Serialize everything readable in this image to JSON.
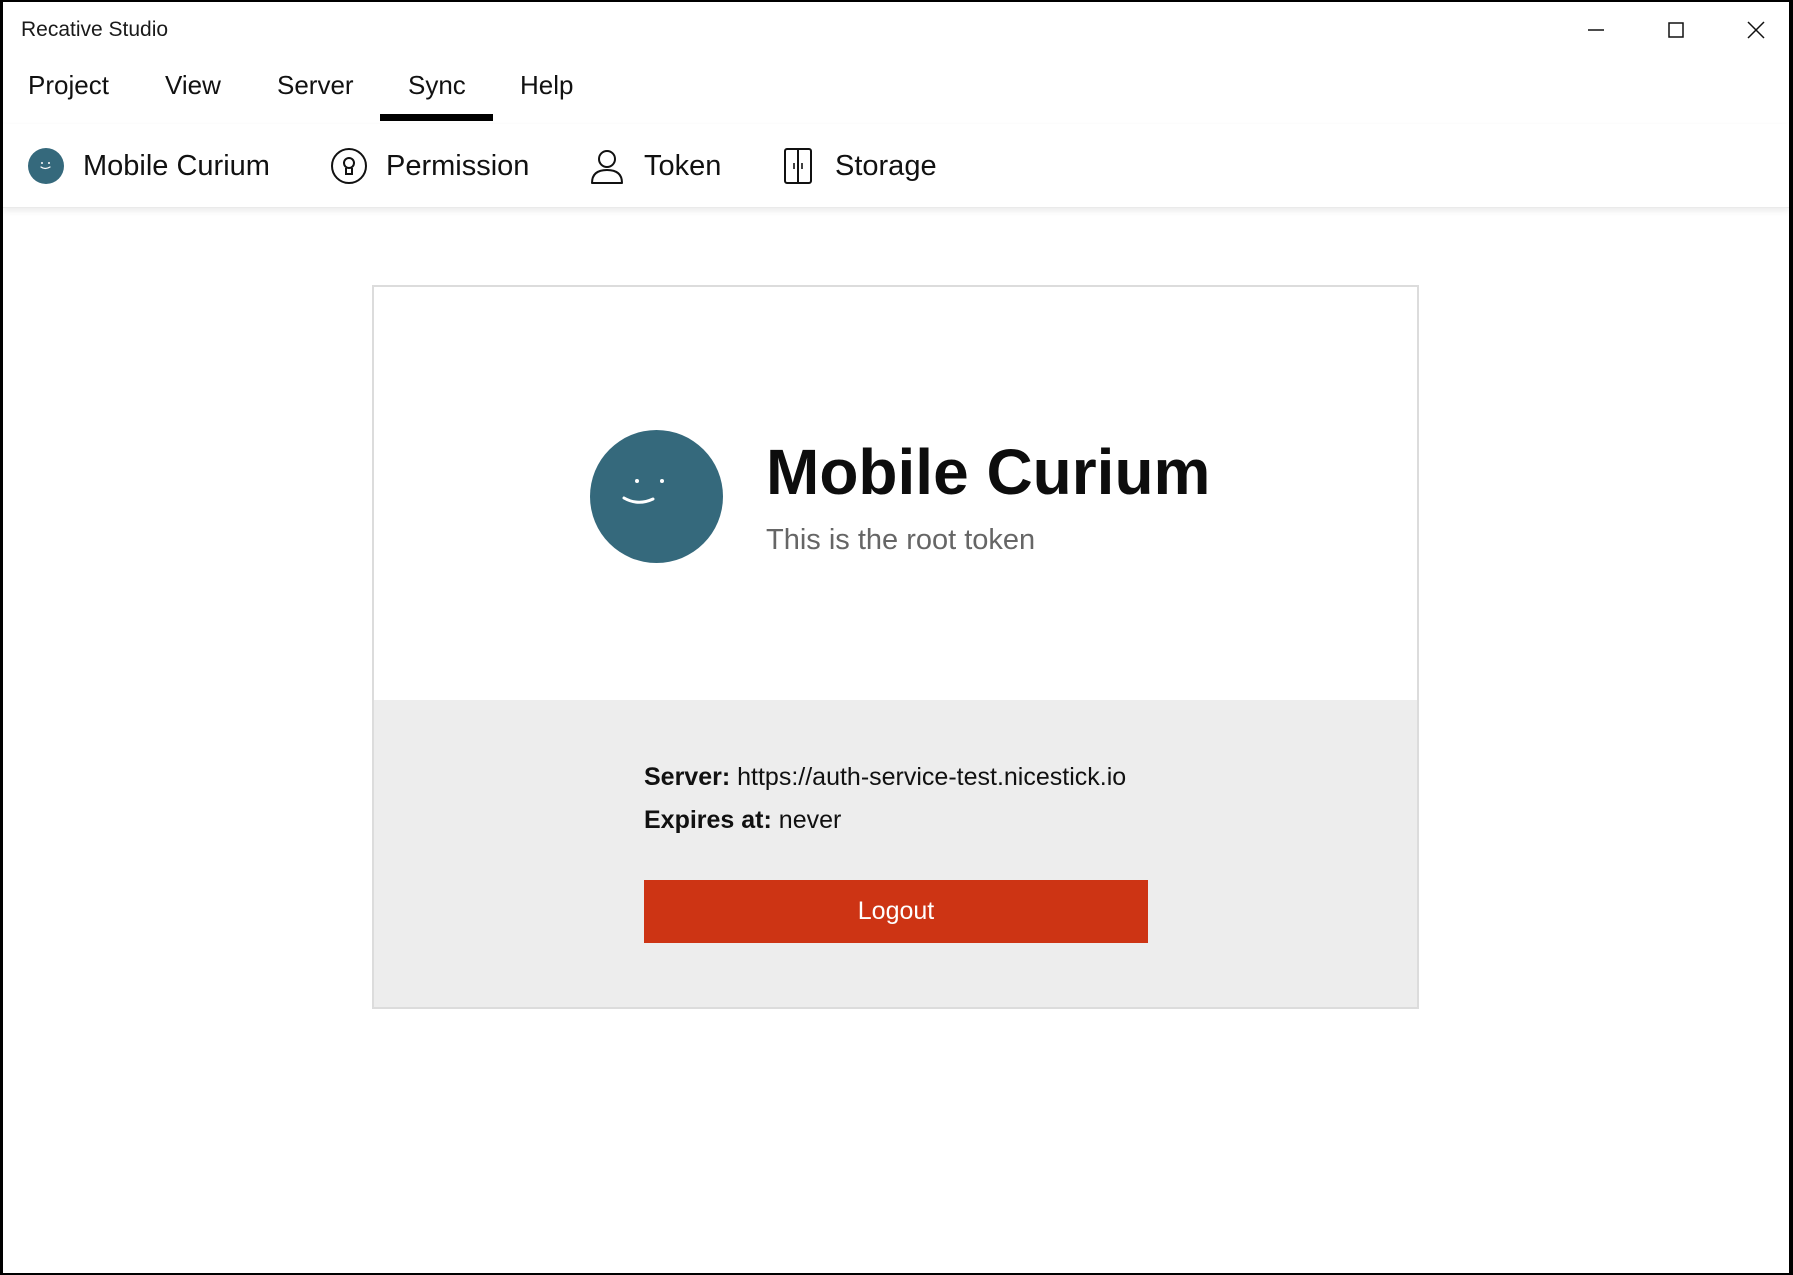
{
  "window": {
    "title": "Recative Studio"
  },
  "menu": {
    "items": [
      "Project",
      "View",
      "Server",
      "Sync",
      "Help"
    ],
    "active": "Sync"
  },
  "toolbar": {
    "items": [
      {
        "label": "Mobile Curium",
        "icon": "avatar-icon"
      },
      {
        "label": "Permission",
        "icon": "permission-icon"
      },
      {
        "label": "Token",
        "icon": "user-icon"
      },
      {
        "label": "Storage",
        "icon": "storage-icon"
      }
    ]
  },
  "card": {
    "title": "Mobile Curium",
    "subtitle": "This is the root token",
    "server_label": "Server:",
    "server_value": "https://auth-service-test.nicestick.io",
    "expires_label": "Expires at:",
    "expires_value": "never",
    "logout_label": "Logout"
  },
  "colors": {
    "avatar": "#35697c",
    "logout": "#cd3414",
    "info_panel": "#ededed"
  }
}
